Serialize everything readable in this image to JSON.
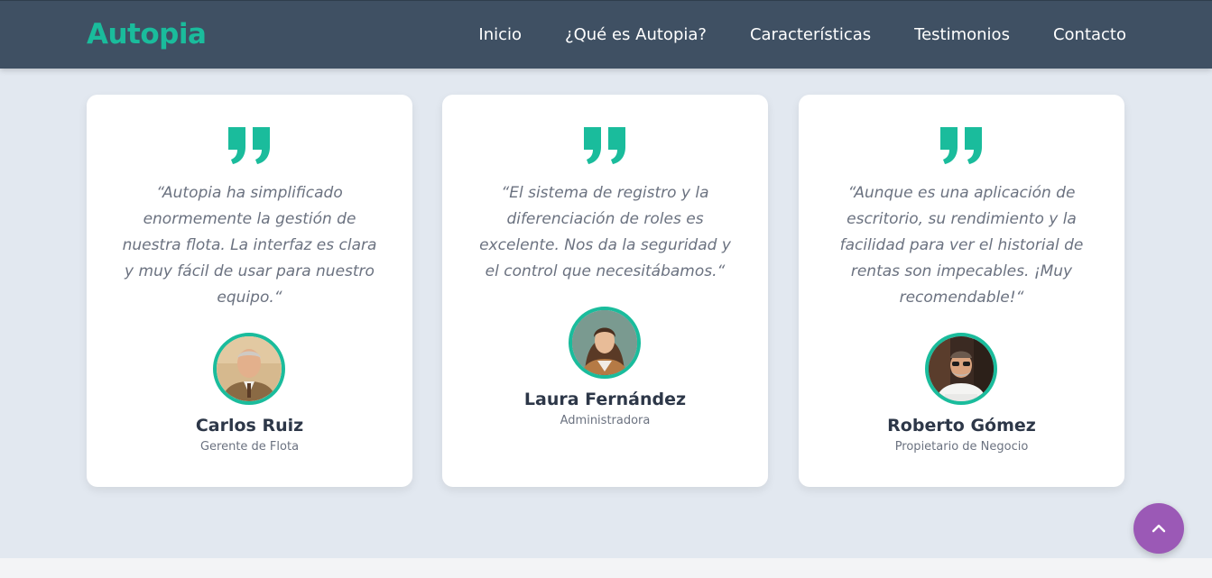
{
  "brand": {
    "name": "Autopia",
    "color": "#1abc9c"
  },
  "nav": {
    "links": [
      {
        "label": "Inicio"
      },
      {
        "label": "¿Qué es Autopia?"
      },
      {
        "label": "Características"
      },
      {
        "label": "Testimonios"
      },
      {
        "label": "Contacto"
      }
    ]
  },
  "testimonials": [
    {
      "icon": "quote-icon",
      "quote": "“Autopia ha simplificado enormemente la gestión de nuestra flota. La interfaz es clara y muy fácil de usar para nuestro equipo.“",
      "name": "Carlos Ruiz",
      "role": "Gerente de Flota"
    },
    {
      "icon": "quote-icon",
      "quote": "“El sistema de registro y la diferenciación de roles es excelente. Nos da la seguridad y el control que necesitábamos.“",
      "name": "Laura Fernández",
      "role": "Administradora"
    },
    {
      "icon": "quote-icon",
      "quote": "“Aunque es una aplicación de escritorio, su rendimiento y la facilidad para ver el historial de rentas son impecables. ¡Muy recomendable!“",
      "name": "Roberto Gómez",
      "role": "Propietario de Negocio"
    }
  ],
  "scroll_top": {
    "icon": "chevron-up-icon",
    "color": "#9b59b6"
  },
  "colors": {
    "accent": "#1abc9c",
    "navbar": "#3f5063",
    "background": "#e2e8f0"
  }
}
